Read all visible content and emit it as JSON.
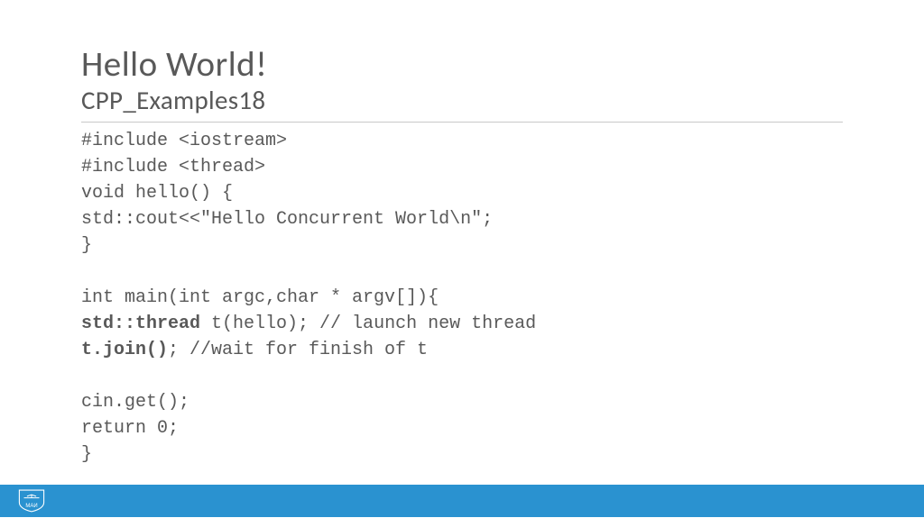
{
  "header": {
    "title": "Hello World!",
    "subtitle": "CPP_Examples18"
  },
  "code": {
    "lines": [
      {
        "text": "#include <iostream>",
        "bold": false
      },
      {
        "text": "#include <thread>",
        "bold": false
      },
      {
        "text": "void hello() {",
        "bold": false
      },
      {
        "text": "std::cout<<\"Hello Concurrent World\\n\";",
        "bold": false
      },
      {
        "text": "}",
        "bold": false
      },
      {
        "text": "",
        "bold": false
      },
      {
        "text": "int main(int argc,char * argv[]){",
        "bold": false
      },
      {
        "segments": [
          {
            "text": "std::thread",
            "bold": true
          },
          {
            "text": " t(hello); // launch new thread",
            "bold": false
          }
        ]
      },
      {
        "segments": [
          {
            "text": "t.join()",
            "bold": true
          },
          {
            "text": "; //wait for finish of t",
            "bold": false
          }
        ]
      },
      {
        "text": "",
        "bold": false
      },
      {
        "text": "cin.get();",
        "bold": false
      },
      {
        "text": "return 0;",
        "bold": false
      },
      {
        "text": "}",
        "bold": false
      }
    ]
  },
  "footer": {
    "logo_text": "МАИ"
  }
}
